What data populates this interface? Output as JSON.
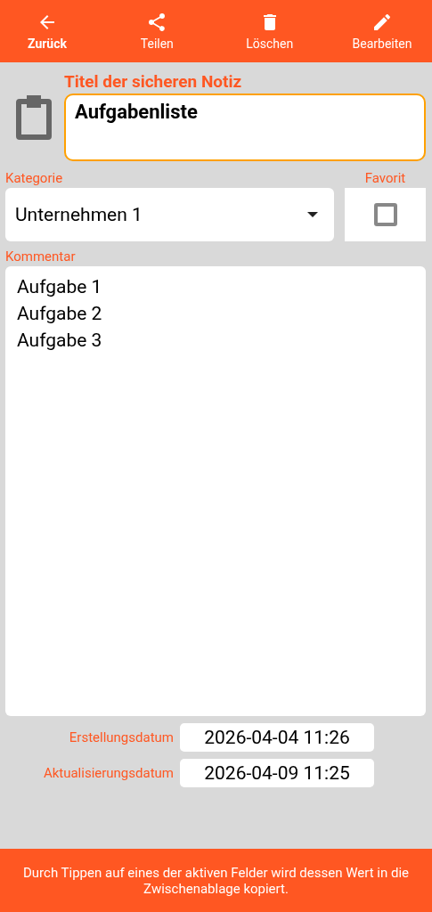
{
  "toolbar": [
    {
      "label": "Zurück",
      "kind": "primary"
    },
    {
      "label": "Teilen",
      "kind": "share"
    },
    {
      "label": "Löschen",
      "kind": "delete"
    },
    {
      "label": "Bearbeiten",
      "kind": "edit"
    }
  ],
  "title_field": {
    "label": "Titel der sicheren Notiz",
    "value": "Aufgabenliste"
  },
  "category": {
    "label": "Kategorie",
    "value": "Unternehmen 1"
  },
  "favorite": {
    "label": "Favorit",
    "checked": false
  },
  "comment": {
    "label": "Kommentar",
    "lines": [
      "Aufgabe 1",
      "Aufgabe 2",
      "Aufgabe 3"
    ]
  },
  "dates": [
    {
      "label": "Erstellungsdatum",
      "value": "2026-04-04 11:26"
    },
    {
      "label": "Aktualisierungsdatum",
      "value": "2026-04-09 11:25"
    }
  ],
  "footer": "Durch Tippen auf eines der aktiven Felder wird dessen Wert in die Zwischenablage kopiert."
}
